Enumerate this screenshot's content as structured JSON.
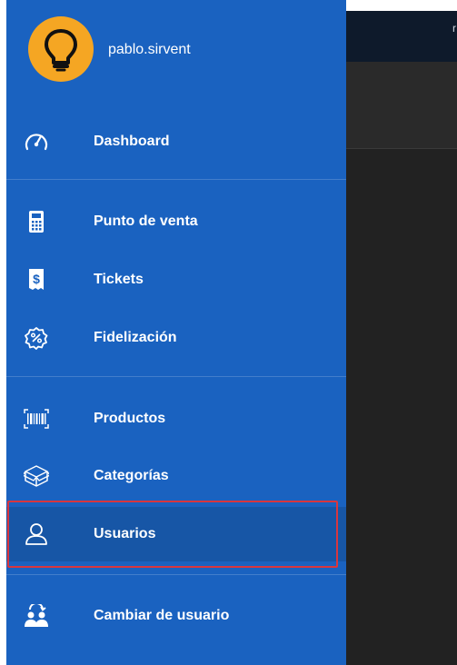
{
  "user": {
    "name": "pablo.sirvent"
  },
  "menu": {
    "dashboard": "Dashboard",
    "pos": "Punto de venta",
    "tickets": "Tickets",
    "loyalty": "Fidelización",
    "products": "Productos",
    "categories": "Categorías",
    "users": "Usuarios",
    "switch_user": "Cambiar de usuario"
  },
  "colors": {
    "drawer": "#1a62c0",
    "selected": "#1756a6",
    "avatar": "#f5a623",
    "highlight": "#d9363e"
  },
  "icons": {
    "avatar": "lightbulb-icon",
    "dashboard": "speedometer-icon",
    "pos": "calculator-icon",
    "tickets": "receipt-icon",
    "loyalty": "percent-badge-icon",
    "products": "barcode-icon",
    "categories": "box-icon",
    "users": "user-icon",
    "switch_user": "users-switch-icon"
  }
}
